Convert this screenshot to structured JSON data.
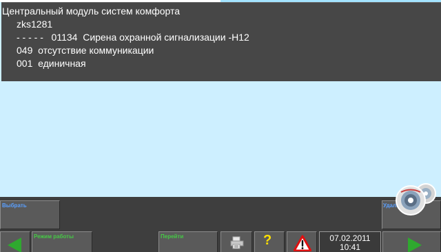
{
  "fault": {
    "title": "Центральный модуль систем комфорта",
    "code": "zks1281",
    "fault_line": "- - - - -   01134  Сирена охранной сигнализации -H12",
    "fault_type": "049  отсутствие коммуникации",
    "frequency": "001  единичная"
  },
  "footer": {
    "select_label": "Выбрать",
    "delete_label": "Удалить",
    "mode_label": "Режим работы",
    "goto_label": "Перейти",
    "help_glyph": "?",
    "date": "07.02.2011",
    "time": "10:41"
  },
  "icons": {
    "back": "back-arrow-icon",
    "forward": "forward-arrow-icon",
    "print": "printer-icon",
    "help": "help-icon",
    "warning": "warning-icon",
    "status": "disc-icon"
  },
  "colors": {
    "panel_bg": "#474747",
    "workspace_bg": "#cdefff",
    "footer_bg": "#3e3e3e",
    "label_blue": "#5aa0ff",
    "label_green": "#46c846",
    "arrow_green": "#2fa82f",
    "help_yellow": "#ffe000",
    "warning_red": "#e01010"
  }
}
